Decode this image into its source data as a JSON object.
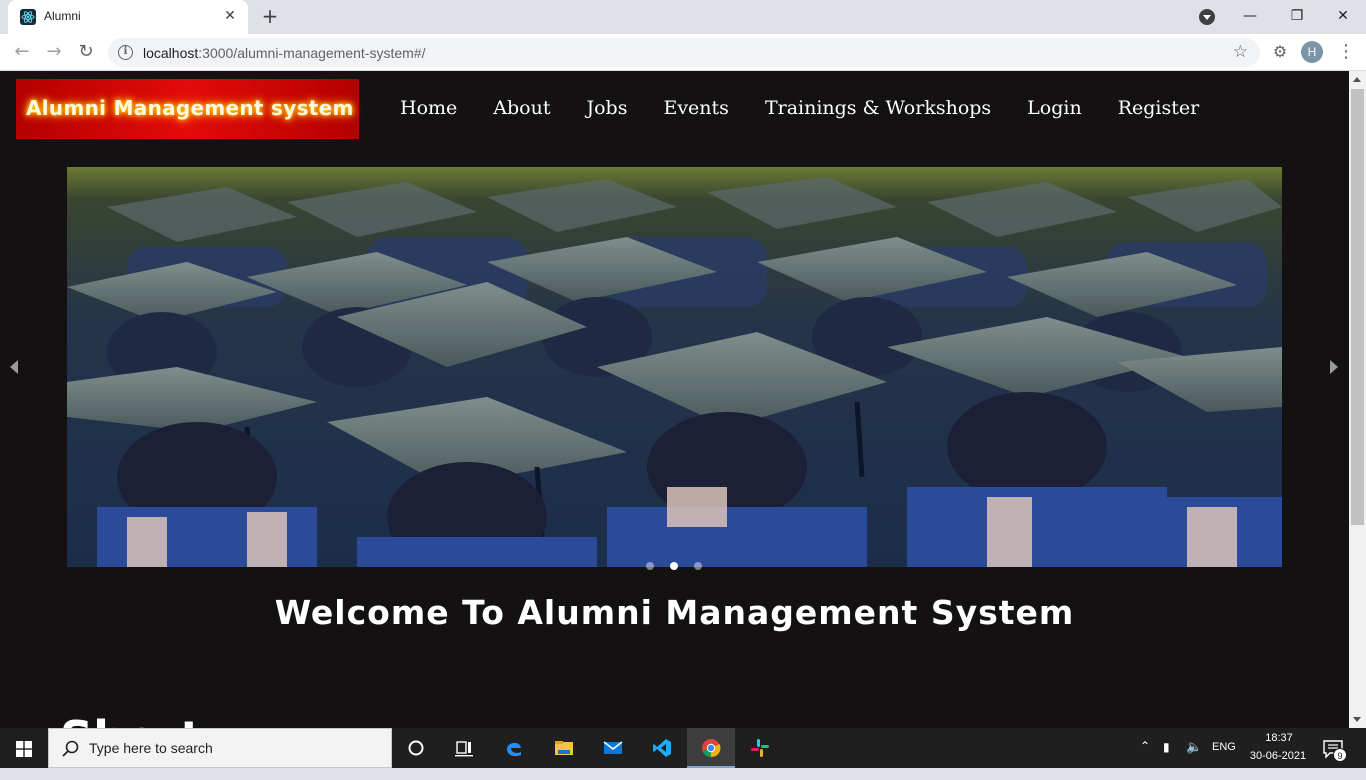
{
  "browser": {
    "tab_title": "Alumni",
    "tab_close": "✕",
    "new_tab": "+",
    "url_host": "localhost",
    "url_rest": ":3000/alumni-management-system#/",
    "profile_initial": "H",
    "window_minimize": "—",
    "window_restore": "❐",
    "window_close": "✕"
  },
  "page": {
    "brand": "Alumni Management system",
    "nav": [
      "Home",
      "About",
      "Jobs",
      "Events",
      "Trainings & Workshops",
      "Login",
      "Register"
    ],
    "carousel": {
      "slide_count": 3,
      "active_index": 1,
      "image": "graduation caps crowd"
    },
    "welcome": "Welcome To Alumni Management System",
    "partial_heading": "Short"
  },
  "taskbar": {
    "search_placeholder": "Type here to search",
    "language": "ENG",
    "time": "18:37",
    "date": "30-06-2021",
    "notification_count": "9",
    "pinned": [
      "cortana",
      "task-view",
      "edge",
      "file-explorer",
      "mail",
      "vscode",
      "chrome",
      "slack"
    ]
  },
  "colors": {
    "page_bg": "#131112",
    "brand_bg": "#e30b0b",
    "taskbar_bg": "#1f1f1f"
  }
}
